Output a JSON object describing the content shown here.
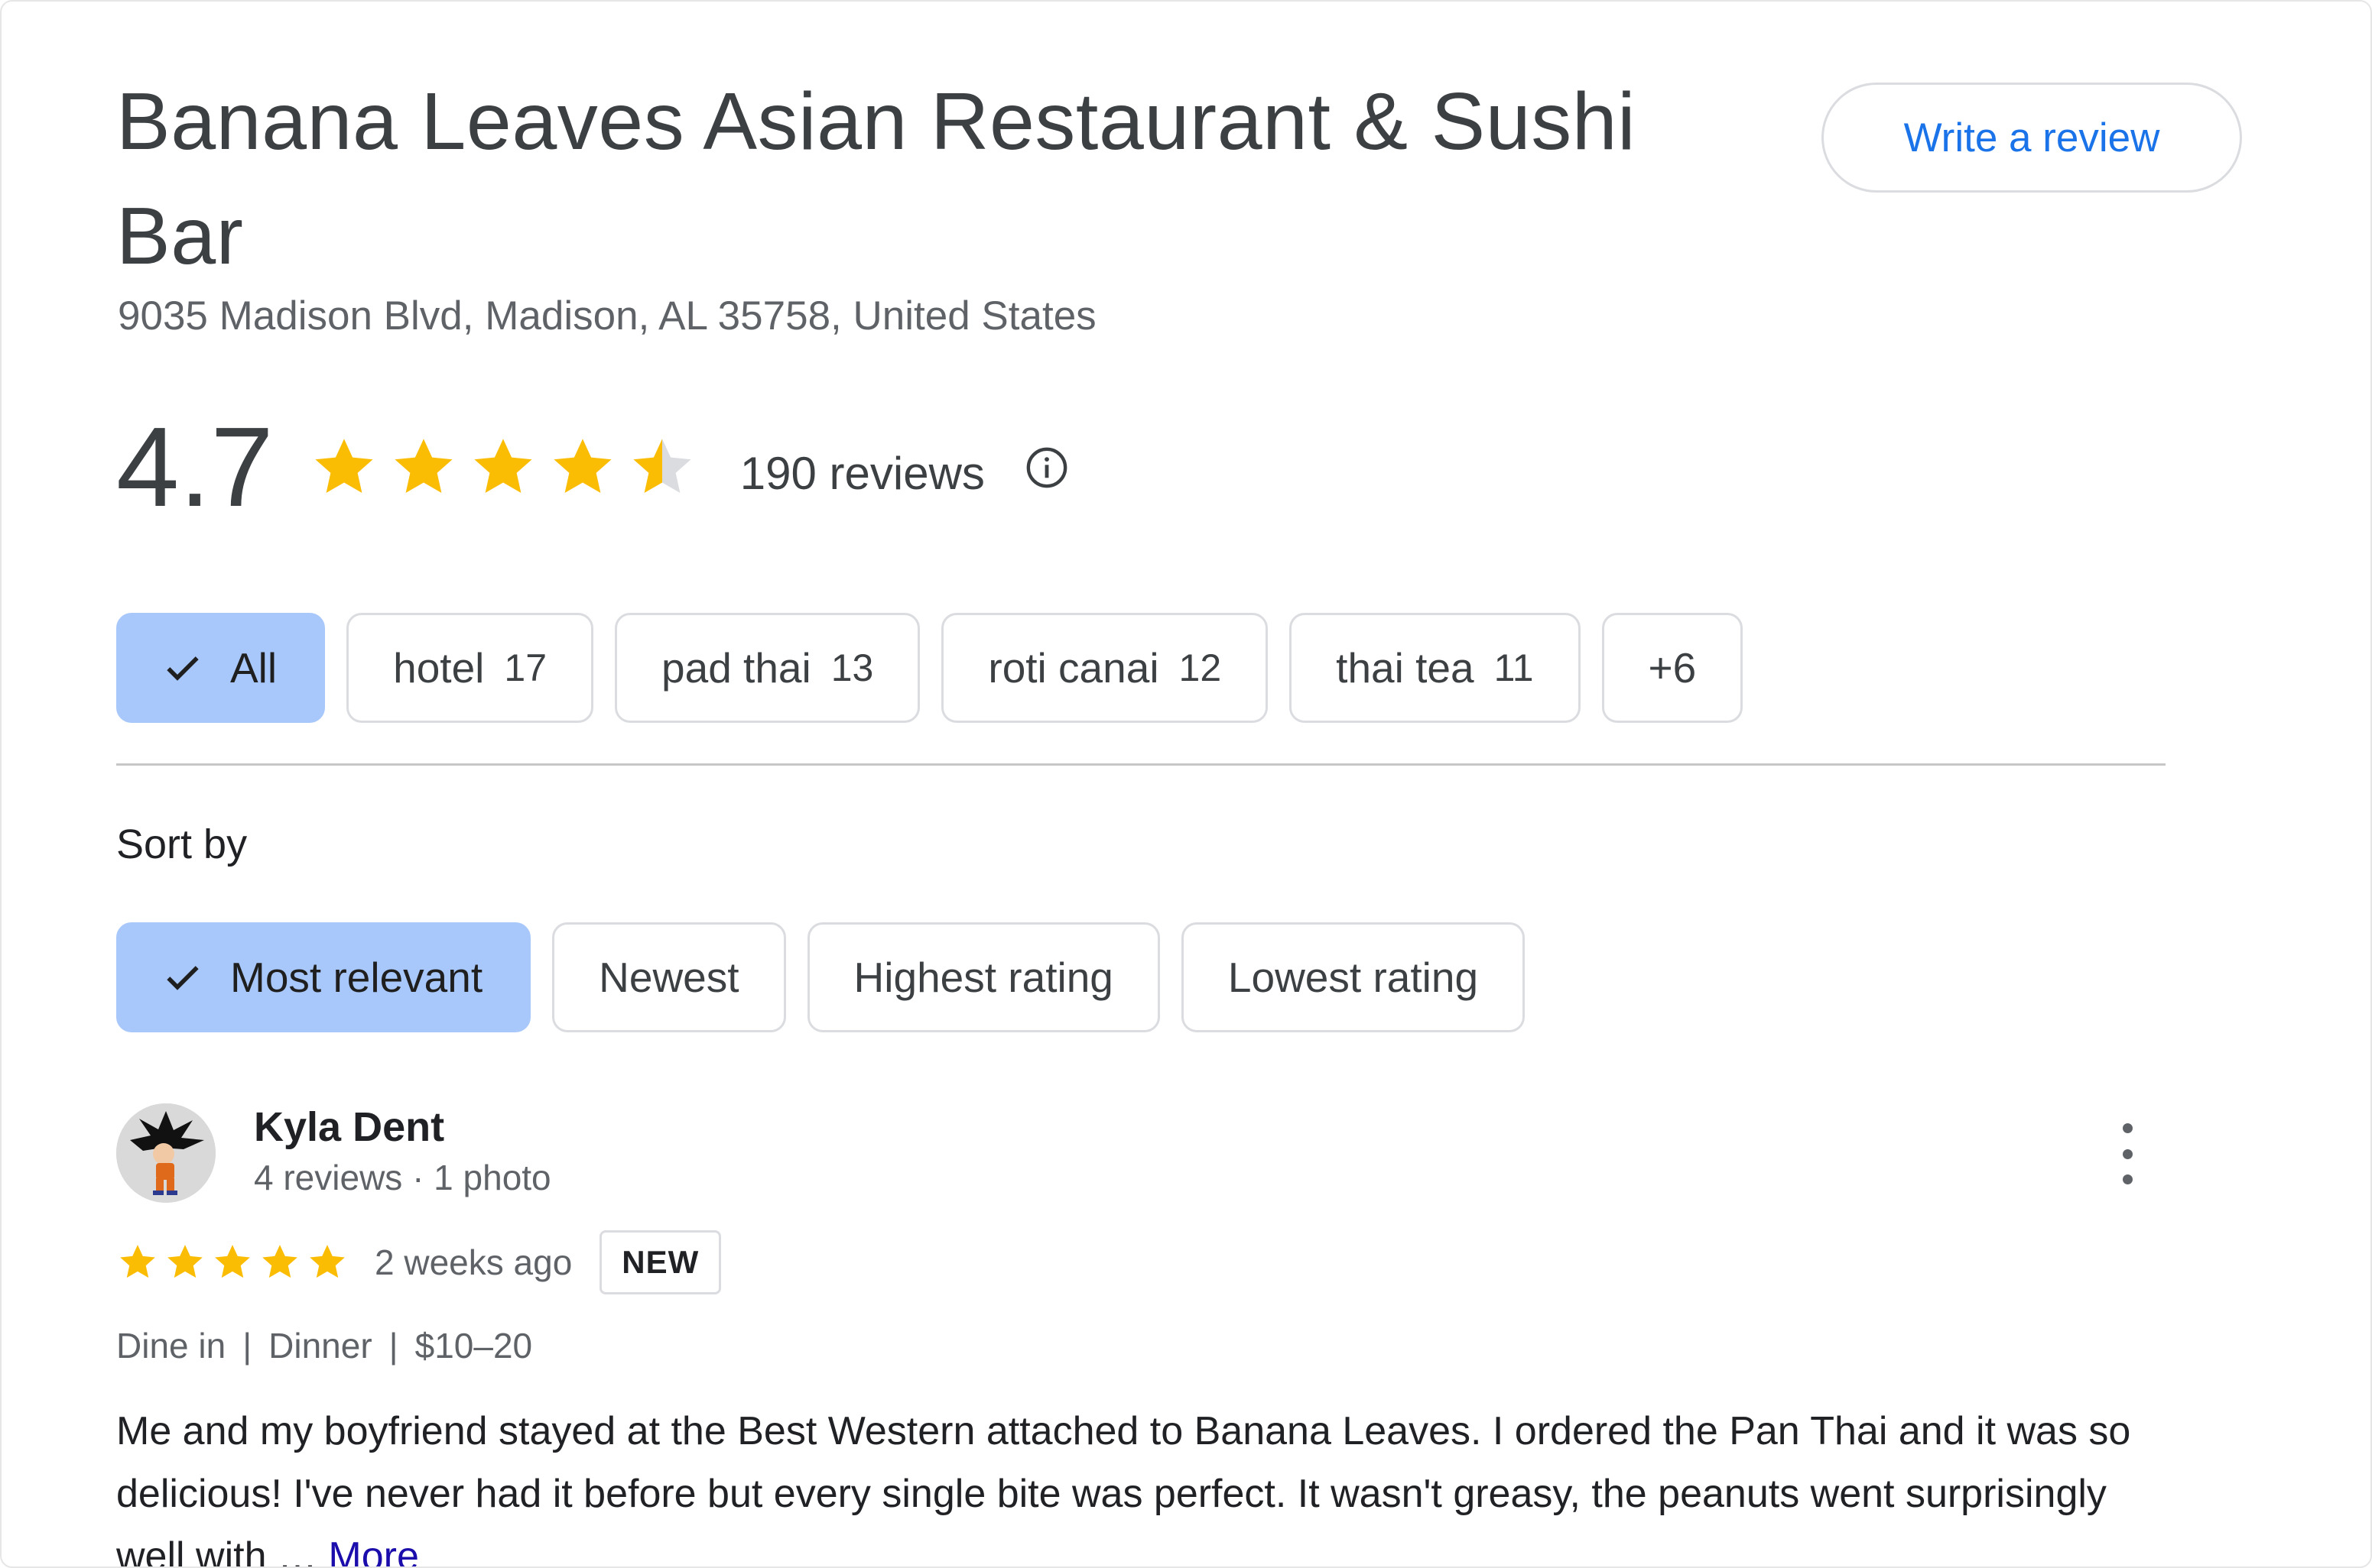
{
  "place": {
    "name": "Banana Leaves Asian Restaurant & Sushi Bar",
    "address": "9035 Madison Blvd, Madison, AL 35758, United States",
    "write_review_label": "Write a review"
  },
  "rating": {
    "value": "4.7",
    "stars_filled": 4.7,
    "stars_max": 5,
    "review_count_label": "190 reviews",
    "info_icon": "info-icon",
    "star_color": "#fbbc04",
    "star_empty_color": "#dadce0"
  },
  "topics": [
    {
      "label": "All",
      "count": "",
      "selected": true
    },
    {
      "label": "hotel",
      "count": "17",
      "selected": false
    },
    {
      "label": "pad thai",
      "count": "13",
      "selected": false
    },
    {
      "label": "roti canai",
      "count": "12",
      "selected": false
    },
    {
      "label": "thai tea",
      "count": "11",
      "selected": false
    },
    {
      "label": "+6",
      "count": "",
      "selected": false
    }
  ],
  "sort": {
    "label": "Sort by",
    "options": [
      {
        "label": "Most relevant",
        "selected": true
      },
      {
        "label": "Newest",
        "selected": false
      },
      {
        "label": "Highest rating",
        "selected": false
      },
      {
        "label": "Lowest rating",
        "selected": false
      }
    ]
  },
  "review": {
    "reviewer_name": "Kyla Dent",
    "reviewer_meta": "4 reviews · 1 photo",
    "stars": 5,
    "time_ago": "2 weeks ago",
    "badge": "NEW",
    "context": [
      "Dine in",
      "Dinner",
      "$10–20"
    ],
    "text": "Me and my boyfriend stayed at the Best Western attached to Banana Leaves. I ordered the Pan Thai and it was so delicious! I've never had it before but every single bite was perfect. It wasn't greasy, the peanuts went surprisingly well with …",
    "more_label": "More",
    "menu_icon": "more-vert-icon"
  },
  "colors": {
    "accent_blue": "#1a73e8",
    "chip_selected_bg": "#a8c7fa",
    "more_link": "#1a0dab"
  }
}
